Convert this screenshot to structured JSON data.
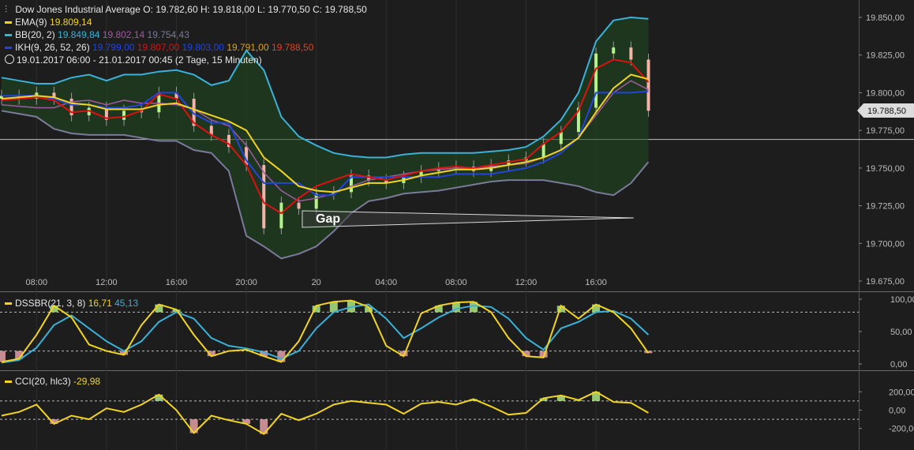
{
  "instrument": "Dow Jones Industrial Average",
  "ohlc": {
    "o": "O: 19.782,60",
    "h": "H: 19.818,00",
    "l": "L: 19.770,50",
    "c": "C: 19.788,50"
  },
  "legend": {
    "ema": {
      "label": "EMA(9)",
      "value": "19.809,14",
      "color": "#f2d422"
    },
    "bb": {
      "label": "BB(20, 2)",
      "v1": "19.849,84",
      "v2": "19.802,14",
      "v3": "19.754,43",
      "c1": "#3ab1d8",
      "c2": "#a05aa0",
      "c3": "#7a7a9a"
    },
    "ikh": {
      "label": "IKH(9, 26, 52, 26)",
      "v1": "19.799,00",
      "v2": "19.807,00",
      "v3": "19.803,00",
      "v4": "19.791,00",
      "v5": "19.788,50",
      "c1": "#2244dd",
      "c2": "#dd1111",
      "c3": "#2244dd",
      "c4": "#d9a020",
      "c5": "#dd4422"
    },
    "range": "19.01.2017 06:00 - 21.01.2017 00:45",
    "duration": "(2 Tage, 15 Minuten)"
  },
  "annotation": "Gap",
  "last_price": "19.788,50",
  "dssbr": {
    "label": "DSSBR(21, 3, 8)",
    "v1": "16,71",
    "v2": "45,13"
  },
  "cci": {
    "label": "CCI(20, hlc3)",
    "v1": "-29,98"
  },
  "chart_data": [
    {
      "type": "line",
      "panel": "price",
      "ylim": [
        19675,
        19850
      ],
      "yticks": [
        "19.850,00",
        "19.825,00",
        "19.800,00",
        "19.775,00",
        "19.750,00",
        "19.725,00",
        "19.700,00",
        "19.675,00"
      ],
      "ytick_values": [
        19850,
        19825,
        19800,
        19775,
        19750,
        19725,
        19700,
        19675
      ],
      "xticks": [
        "08:00",
        "12:00",
        "16:00",
        "20:00",
        "20",
        "04:00",
        "08:00",
        "12:00",
        "16:00"
      ],
      "xtick_hours": [
        2,
        6,
        10,
        14,
        18,
        22,
        26,
        30,
        34
      ],
      "horizontal_line": 19769,
      "close_x_hours": [
        0,
        1,
        2,
        3,
        4,
        5,
        6,
        7,
        8,
        9,
        10,
        11,
        12,
        13,
        14,
        15,
        16,
        17,
        18,
        19,
        20,
        21,
        22,
        23,
        24,
        25,
        26,
        27,
        28,
        29,
        30,
        31,
        32,
        33,
        34,
        35,
        36,
        37
      ],
      "close": [
        19798,
        19796,
        19800,
        19796,
        19785,
        19790,
        19782,
        19788,
        19787,
        19800,
        19796,
        19778,
        19772,
        19764,
        19752,
        19710,
        19727,
        19723,
        19733,
        19734,
        19745,
        19742,
        19740,
        19744,
        19748,
        19750,
        19751,
        19748,
        19752,
        19755,
        19757,
        19766,
        19774,
        19790,
        19826,
        19830,
        19822,
        19788
      ],
      "ema": [
        19796,
        19797,
        19798,
        19797,
        19793,
        19792,
        19789,
        19789,
        19789,
        19792,
        19793,
        19789,
        19785,
        19781,
        19775,
        19757,
        19748,
        19738,
        19735,
        19734,
        19737,
        19740,
        19740,
        19742,
        19745,
        19747,
        19749,
        19749,
        19750,
        19752,
        19754,
        19757,
        19762,
        19770,
        19787,
        19803,
        19812,
        19809
      ],
      "bb_upper": [
        19810,
        19808,
        19806,
        19806,
        19810,
        19812,
        19808,
        19812,
        19812,
        19814,
        19815,
        19812,
        19805,
        19808,
        19828,
        19815,
        19784,
        19771,
        19765,
        19760,
        19758,
        19757,
        19757,
        19759,
        19760,
        19760,
        19760,
        19760,
        19761,
        19762,
        19764,
        19771,
        19782,
        19800,
        19834,
        19848,
        19850,
        19849
      ],
      "bb_middle": [
        19792,
        19791,
        19790,
        19790,
        19794,
        19795,
        19792,
        19795,
        19793,
        19793,
        19792,
        19789,
        19782,
        19778,
        19765,
        19747,
        19735,
        19728,
        19730,
        19733,
        19738,
        19742,
        19744,
        19746,
        19748,
        19749,
        19750,
        19750,
        19751,
        19752,
        19753,
        19757,
        19762,
        19770,
        19785,
        19800,
        19808,
        19802
      ],
      "bb_lower": [
        19788,
        19786,
        19784,
        19776,
        19773,
        19772,
        19772,
        19772,
        19770,
        19768,
        19768,
        19762,
        19760,
        19748,
        19705,
        19698,
        19690,
        19693,
        19698,
        19708,
        19720,
        19728,
        19730,
        19733,
        19734,
        19735,
        19737,
        19739,
        19741,
        19742,
        19742,
        19742,
        19740,
        19738,
        19734,
        19732,
        19740,
        19754
      ],
      "ikh_tenkan": [
        19795,
        19796,
        19797,
        19795,
        19787,
        19788,
        19783,
        19784,
        19788,
        19799,
        19796,
        19780,
        19772,
        19766,
        19752,
        19727,
        19720,
        19730,
        19738,
        19742,
        19746,
        19744,
        19742,
        19745,
        19748,
        19750,
        19751,
        19750,
        19752,
        19754,
        19756,
        19766,
        19774,
        19788,
        19816,
        19822,
        19820,
        19807
      ],
      "ikh_kijun": [
        19798,
        19798,
        19798,
        19796,
        19792,
        19792,
        19790,
        19790,
        19792,
        19800,
        19800,
        19786,
        19780,
        19780,
        19755,
        19740,
        19740,
        19740,
        19732,
        19732,
        19744,
        19744,
        19744,
        19744,
        19744,
        19744,
        19746,
        19746,
        19746,
        19748,
        19750,
        19754,
        19760,
        19770,
        19800,
        19800,
        19800,
        19801
      ],
      "ikh_senkou_a": [
        19800,
        19798,
        19798,
        19796,
        19795,
        19795,
        19793,
        19793,
        19792,
        19792,
        19792,
        19788,
        19785,
        19780,
        19770,
        19755,
        19745,
        19742,
        19740,
        19742,
        19745,
        19748,
        19749,
        19750,
        19752,
        19753,
        19755,
        19760,
        19765,
        19770,
        19778,
        19790,
        19800,
        19806,
        19812,
        19818,
        19822,
        19824
      ],
      "ikh_senkou_b": [
        19792,
        19790,
        19788,
        19786,
        19784,
        19782,
        19780,
        19778,
        19776,
        19774,
        19772,
        19770,
        19766,
        19760,
        19745,
        19728,
        19718,
        19715,
        19715,
        19720,
        19728,
        19732,
        19735,
        19738,
        19740,
        19742,
        19744,
        19746,
        19748,
        19750,
        19752,
        19754,
        19758,
        19760,
        19765,
        19770,
        19774,
        19778
      ]
    },
    {
      "type": "line",
      "panel": "dssbr",
      "ylim": [
        0,
        100
      ],
      "yticks": [
        "100,00",
        "50,00",
        "0,00"
      ],
      "ytick_values": [
        100,
        50,
        0
      ],
      "levels": [
        80,
        20
      ],
      "x_hours": [
        0,
        1,
        2,
        3,
        4,
        5,
        6,
        7,
        8,
        9,
        10,
        11,
        12,
        13,
        14,
        15,
        16,
        17,
        18,
        19,
        20,
        21,
        22,
        23,
        24,
        25,
        26,
        27,
        28,
        29,
        30,
        31,
        32,
        33,
        34,
        35,
        36,
        37
      ],
      "fast": [
        3,
        8,
        45,
        90,
        72,
        30,
        20,
        14,
        60,
        92,
        84,
        45,
        12,
        20,
        22,
        12,
        3,
        35,
        90,
        96,
        98,
        88,
        28,
        12,
        78,
        90,
        95,
        96,
        80,
        40,
        12,
        10,
        90,
        70,
        92,
        80,
        55,
        16.71
      ],
      "slow": [
        2,
        6,
        25,
        60,
        75,
        55,
        35,
        20,
        35,
        65,
        80,
        70,
        40,
        28,
        24,
        18,
        8,
        20,
        55,
        80,
        88,
        92,
        70,
        40,
        55,
        72,
        85,
        90,
        88,
        70,
        40,
        22,
        55,
        65,
        80,
        82,
        70,
        45.13
      ]
    },
    {
      "type": "line",
      "panel": "cci",
      "ylim": [
        -280,
        280
      ],
      "yticks": [
        "200,00",
        "0,00",
        "-200,00"
      ],
      "ytick_values": [
        200,
        0,
        -200
      ],
      "levels": [
        100,
        -100
      ],
      "x_hours": [
        0,
        1,
        2,
        3,
        4,
        5,
        6,
        7,
        8,
        9,
        10,
        11,
        12,
        13,
        14,
        15,
        16,
        17,
        18,
        19,
        20,
        21,
        22,
        23,
        24,
        25,
        26,
        27,
        28,
        29,
        30,
        31,
        32,
        33,
        34,
        35,
        36,
        37
      ],
      "values": [
        -60,
        -20,
        60,
        -150,
        -60,
        -100,
        20,
        -20,
        60,
        170,
        0,
        -250,
        -60,
        -110,
        -150,
        -260,
        -40,
        -110,
        -40,
        60,
        100,
        80,
        60,
        -40,
        70,
        90,
        60,
        120,
        40,
        -50,
        -30,
        130,
        160,
        110,
        200,
        90,
        80,
        -29.98
      ]
    }
  ]
}
